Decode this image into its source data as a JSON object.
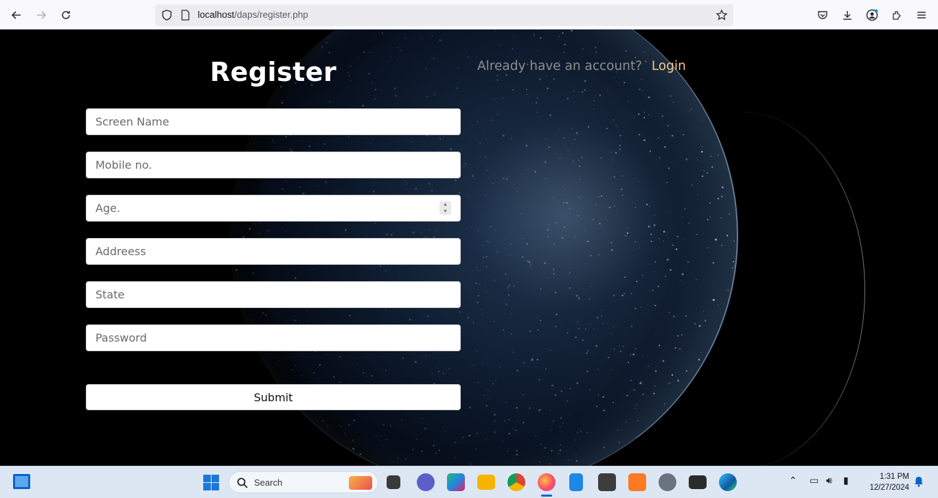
{
  "browser": {
    "url_host": "localhost",
    "url_path": "/daps/register.php",
    "buttons": [
      "back",
      "forward",
      "reload",
      "pocket",
      "downloads",
      "account",
      "extensions",
      "menu"
    ]
  },
  "page": {
    "title": "Register",
    "already_text": "Already have an account?",
    "login_link": "Login",
    "fields": {
      "screen_name": "Screen Name",
      "mobile": "Mobile no.",
      "age": "Age.",
      "address": "Addreess",
      "state": "State",
      "password": "Password"
    },
    "submit_label": "Submit"
  },
  "taskbar": {
    "search_label": "Search",
    "time": "1:31 PM",
    "date": "12/27/2024",
    "apps": [
      "task-view",
      "teams",
      "copilot",
      "file-explorer",
      "chrome",
      "firefox",
      "notepad",
      "sublime-text",
      "xampp",
      "settings",
      "terminal",
      "edge"
    ]
  },
  "colors": {
    "login_link": "#f5c98c",
    "background": "#000000",
    "taskbar": "#dde7f3"
  }
}
